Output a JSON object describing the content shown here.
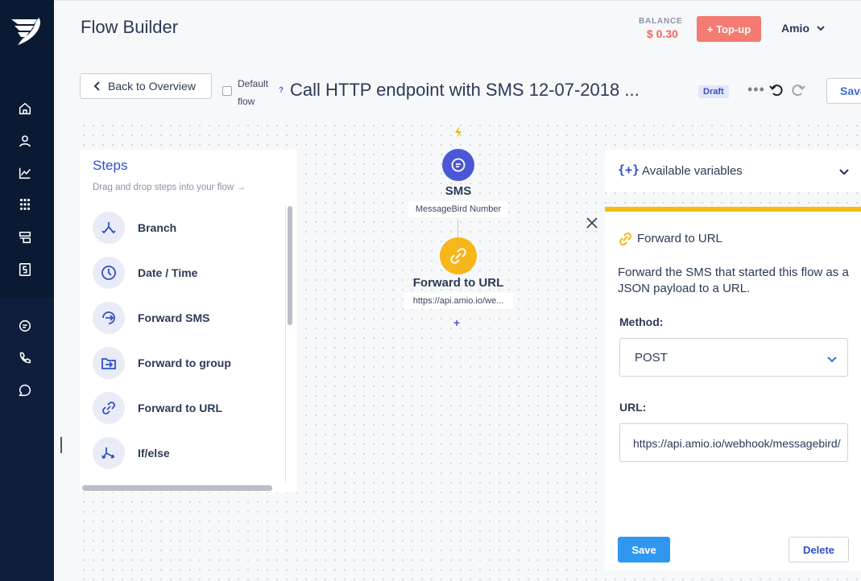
{
  "app": {
    "title": "Flow Builder"
  },
  "header": {
    "balance_label": "BALANCE",
    "balance_value": "$ 0.30",
    "topup_label": "+ Top-up",
    "user_name": "Amio"
  },
  "toolbar": {
    "back_label": "Back to Overview",
    "default_label": "Default flow",
    "default_checked": false,
    "help_glyph": "?",
    "flow_name": "Call HTTP endpoint with SMS 12-07-2018 ...",
    "status_badge": "Draft",
    "more_glyph": "•••",
    "save_label": "Save"
  },
  "sidebar": {
    "items": [
      {
        "icon": "home-icon"
      },
      {
        "icon": "user-icon"
      },
      {
        "icon": "chart-icon"
      },
      {
        "icon": "apps-grid-icon"
      },
      {
        "icon": "layout-icon"
      },
      {
        "icon": "billing-icon"
      },
      {
        "icon": "chat-icon"
      },
      {
        "icon": "phone-icon"
      },
      {
        "icon": "conversations-icon"
      }
    ]
  },
  "steps": {
    "title": "Steps",
    "hint": "Drag and drop steps into your flow →",
    "items": [
      {
        "label": "Branch",
        "icon": "branch-icon"
      },
      {
        "label": "Date / Time",
        "icon": "clock-icon"
      },
      {
        "label": "Forward SMS",
        "icon": "forward-sms-icon"
      },
      {
        "label": "Forward to group",
        "icon": "forward-group-icon"
      },
      {
        "label": "Forward to URL",
        "icon": "link-icon"
      },
      {
        "label": "If/else",
        "icon": "split-icon"
      }
    ]
  },
  "flow": {
    "trigger_icon": "bolt-icon",
    "nodes": [
      {
        "title": "SMS",
        "subtitle": "MessageBird Number",
        "color": "#4b57d6",
        "icon": "message-icon"
      },
      {
        "title": "Forward to URL",
        "subtitle": "https://api.amio.io/we...",
        "color": "#f7b619",
        "icon": "link-icon"
      }
    ],
    "add_glyph": "+"
  },
  "variables": {
    "icon_glyph": "{+}",
    "label": "Available variables"
  },
  "detail": {
    "title": "Forward to URL",
    "description": "Forward the SMS that started this flow as a JSON payload to a URL.",
    "method_label": "Method:",
    "method_value": "POST",
    "url_label": "URL:",
    "url_value": "https://api.amio.io/webhook/messagebird/",
    "save_label": "Save",
    "delete_label": "Delete"
  },
  "colors": {
    "sidebar": "#0a1a33",
    "accent_blue": "#2f4fc8",
    "topup": "#f37b71",
    "forward_yellow": "#f5bd13",
    "save_blue": "#3097f0"
  }
}
